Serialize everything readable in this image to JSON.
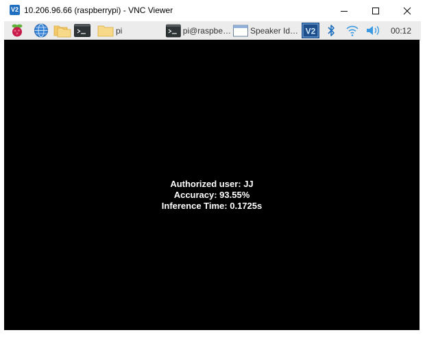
{
  "window": {
    "logo_text": "V2",
    "title": "10.206.96.66 (raspberrypi) - VNC Viewer"
  },
  "taskbar": {
    "tasks": [
      {
        "label": "pi",
        "icon": "folder-icon"
      },
      {
        "label": "pi@raspbe…",
        "icon": "terminal-icon"
      },
      {
        "label": "Speaker Id…",
        "icon": "window-icon"
      }
    ],
    "clock": "00:12",
    "icons": [
      "raspberry-menu-icon",
      "web-browser-icon",
      "file-manager-icon",
      "terminal-icon",
      "vnc-icon",
      "bluetooth-icon",
      "wifi-icon",
      "volume-icon"
    ]
  },
  "screen": {
    "lines": [
      "Authorized user: JJ",
      "Accuracy: 93.55%",
      "Inference Time: 0.1725s"
    ]
  },
  "colors": {
    "desktop_bg": "#000000",
    "taskbar_bg": "#ececec",
    "accent_blue": "#1e6fbf"
  }
}
